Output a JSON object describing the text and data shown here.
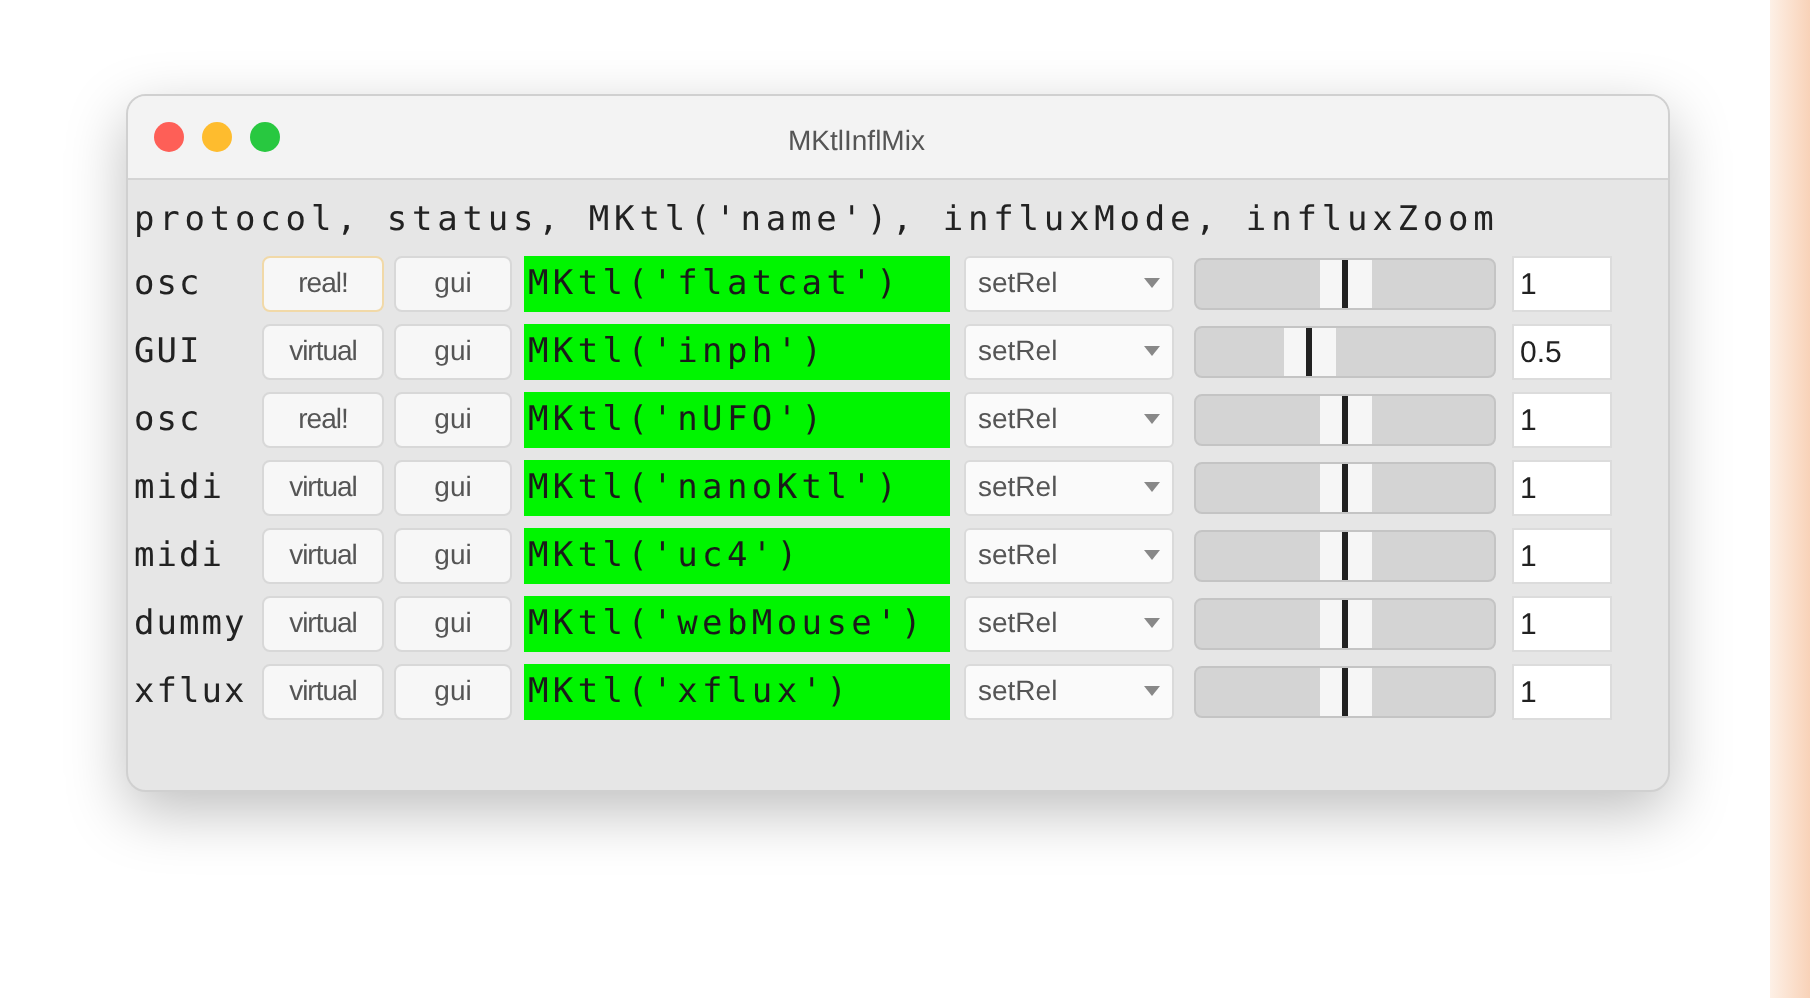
{
  "window": {
    "title": "MKtlInflMix"
  },
  "header": "protocol, status, MKtl('name'), influxMode, influxZoom",
  "rows": [
    {
      "protocol": "osc",
      "status": "real!",
      "status_focused": true,
      "gui": "gui",
      "name": "MKtl('flatcat')",
      "mode": "setRel",
      "level": 0.5,
      "zoom": "1"
    },
    {
      "protocol": "GUI",
      "status": "virtual",
      "status_focused": false,
      "gui": "gui",
      "name": "MKtl('inph')",
      "mode": "setRel",
      "level": 0.38,
      "zoom": "0.5"
    },
    {
      "protocol": "osc",
      "status": "real!",
      "status_focused": false,
      "gui": "gui",
      "name": "MKtl('nUFO')",
      "mode": "setRel",
      "level": 0.5,
      "zoom": "1"
    },
    {
      "protocol": "midi",
      "status": "virtual",
      "status_focused": false,
      "gui": "gui",
      "name": "MKtl('nanoKtl')",
      "mode": "setRel",
      "level": 0.5,
      "zoom": "1"
    },
    {
      "protocol": "midi",
      "status": "virtual",
      "status_focused": false,
      "gui": "gui",
      "name": "MKtl('uc4')",
      "mode": "setRel",
      "level": 0.5,
      "zoom": "1"
    },
    {
      "protocol": "dummy",
      "status": "virtual",
      "status_focused": false,
      "gui": "gui",
      "name": "MKtl('webMouse')",
      "mode": "setRel",
      "level": 0.5,
      "zoom": "1"
    },
    {
      "protocol": "xflux",
      "status": "virtual",
      "status_focused": false,
      "gui": "gui",
      "name": "MKtl('xflux')",
      "mode": "setRel",
      "level": 0.5,
      "zoom": "1"
    }
  ]
}
